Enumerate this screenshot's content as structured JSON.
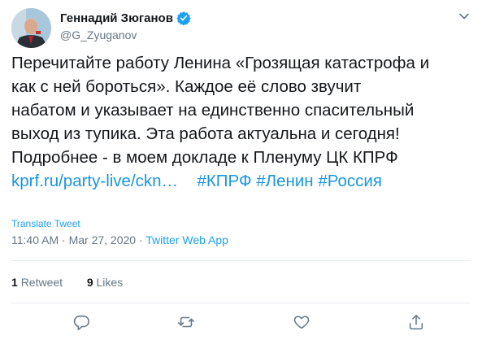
{
  "author": {
    "name": "Геннадий Зюганов",
    "handle": "@G_Zyuganov",
    "verified": true
  },
  "tweet": {
    "lines": [
      "Перечитайте работу Ленина «Грозящая катастрофа и",
      "как с ней бороться». Каждое её слово звучит",
      "набатом и указывает на единственно спасительный",
      "выход из тупика. Эта работа актуальна и сегодня!",
      "Подробнее - в моем докладе к Пленуму ЦК КПРФ"
    ],
    "link": "kprf.ru/party-live/ckn…",
    "hashtags": [
      "#КПРФ",
      "#Ленин",
      "#Россия"
    ]
  },
  "translate_label": "Translate Tweet",
  "meta": {
    "time": "11:40 AM",
    "separator": "·",
    "date": "Mar 27, 2020",
    "app": "Twitter Web App"
  },
  "stats": {
    "retweets_count": "1",
    "retweets_label": "Retweet",
    "likes_count": "9",
    "likes_label": "Likes"
  },
  "colors": {
    "link": "#1b95e0",
    "secondary_text": "#657786",
    "verified_badge": "#1da1f2",
    "divider": "#e6ecf0"
  },
  "icons": [
    "verified-icon",
    "chevron-down-icon",
    "reply-icon",
    "retweet-icon",
    "like-icon",
    "share-icon"
  ]
}
